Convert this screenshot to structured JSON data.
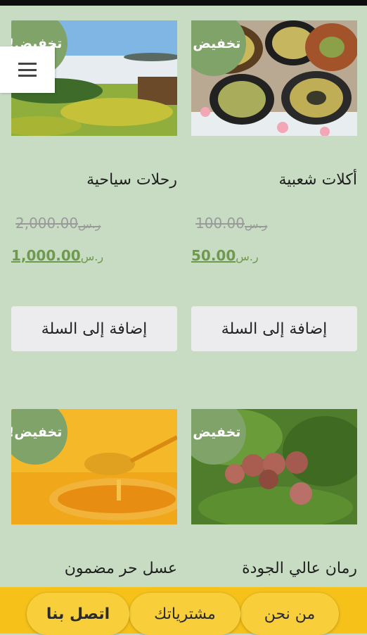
{
  "discount_badge": "تخفيض!",
  "add_to_cart": "إضافة إلى السلة",
  "currency": "ر.س",
  "products": [
    {
      "name": "أكلات شعبية",
      "old_price": "100.00",
      "new_price": "50.00",
      "image": "traditional-dishes"
    },
    {
      "name": "رحلات سياحية",
      "old_price": "2,000.00",
      "new_price": "1,000.00",
      "image": "mountain-landscape"
    },
    {
      "name": "رمان عالي الجودة",
      "image": "pomegranates"
    },
    {
      "name": "عسل حر مضمون",
      "image": "honey-dipper"
    }
  ],
  "nav": {
    "about": "من نحن",
    "purchases": "مشترياتك",
    "contact": "اتصل بنا"
  },
  "menu_icon": "hamburger-icon",
  "colors": {
    "background": "#c8dcc4",
    "badge": "#7fa368",
    "price": "#6f9a4e",
    "nav": "#f6c21a"
  }
}
